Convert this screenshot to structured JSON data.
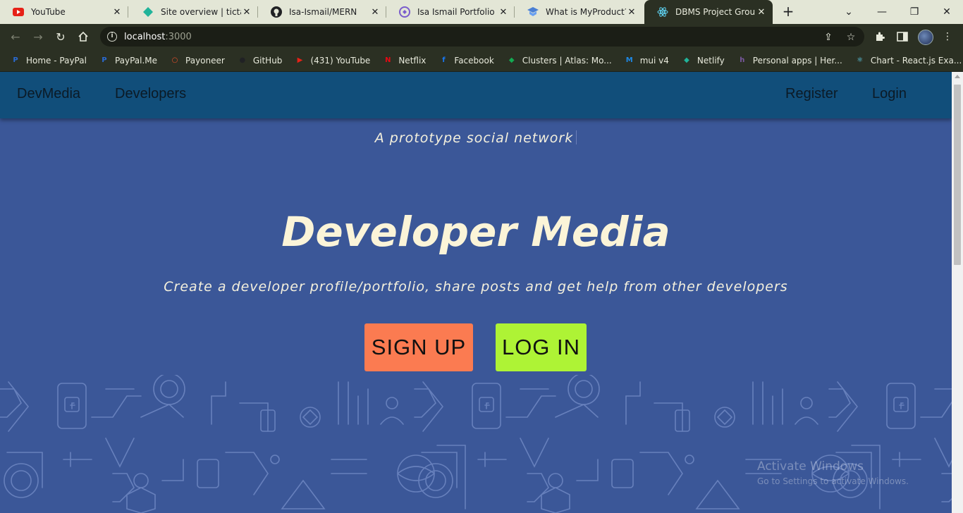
{
  "browser": {
    "tabs": [
      {
        "title": "YouTube",
        "icon": "youtube-icon",
        "active": false
      },
      {
        "title": "Site overview | tictactoe",
        "icon": "netlify-icon",
        "active": false
      },
      {
        "title": "Isa-Ismail/MERN",
        "icon": "github-icon",
        "active": false
      },
      {
        "title": "Isa Ismail Portfolio",
        "icon": "portfolio-icon",
        "active": false
      },
      {
        "title": "What is MyProduct? -",
        "icon": "product-icon",
        "active": false
      },
      {
        "title": "DBMS Project Group-",
        "icon": "react-icon",
        "active": true
      }
    ],
    "url_host": "localhost",
    "url_port": ":3000",
    "bookmarks": [
      {
        "label": "Home - PayPal",
        "icon": "paypal-icon",
        "color": "#2a6ad1",
        "glyph": "P"
      },
      {
        "label": "PayPal.Me",
        "icon": "paypal-icon",
        "color": "#2a6ad1",
        "glyph": "P"
      },
      {
        "label": "Payoneer",
        "icon": "payoneer-icon",
        "color": "#e94f2b",
        "glyph": "○"
      },
      {
        "label": "GitHub",
        "icon": "github-icon",
        "color": "#202124",
        "glyph": "●"
      },
      {
        "label": "(431) YouTube",
        "icon": "youtube-icon",
        "color": "#e62117",
        "glyph": "▶"
      },
      {
        "label": "Netflix",
        "icon": "netflix-icon",
        "color": "#e50914",
        "glyph": "N"
      },
      {
        "label": "Facebook",
        "icon": "facebook-icon",
        "color": "#1877f2",
        "glyph": "f"
      },
      {
        "label": "Clusters | Atlas: Mo...",
        "icon": "mongodb-icon",
        "color": "#13aa52",
        "glyph": "◆"
      },
      {
        "label": "mui v4",
        "icon": "mui-icon",
        "color": "#1e88e5",
        "glyph": "M"
      },
      {
        "label": "Netlify",
        "icon": "netlify-icon",
        "color": "#20b39a",
        "glyph": "◆"
      },
      {
        "label": "Personal apps | Her...",
        "icon": "heroku-icon",
        "color": "#79589f",
        "glyph": "h"
      },
      {
        "label": "Chart - React.js Exa...",
        "icon": "react-icon",
        "color": "#61dafb",
        "glyph": "⚛"
      }
    ]
  },
  "appnav": {
    "brand": "DevMedia",
    "developers": "Developers",
    "register": "Register",
    "login": "Login"
  },
  "hero": {
    "tagline": "A prototype social network",
    "title": "Developer Media",
    "subtitle": "Create a developer profile/portfolio, share posts and get help from other developers",
    "signup_label": "SIGN UP",
    "login_label": "LOG IN"
  },
  "watermark": {
    "line1": "Activate Windows",
    "line2": "Go to Settings to activate Windows."
  },
  "colors": {
    "page_bg": "#3b5798",
    "nav_bg": "#114e7a",
    "signup": "#fb7b51",
    "login": "#aef335",
    "title_text": "#fbf4d8"
  }
}
